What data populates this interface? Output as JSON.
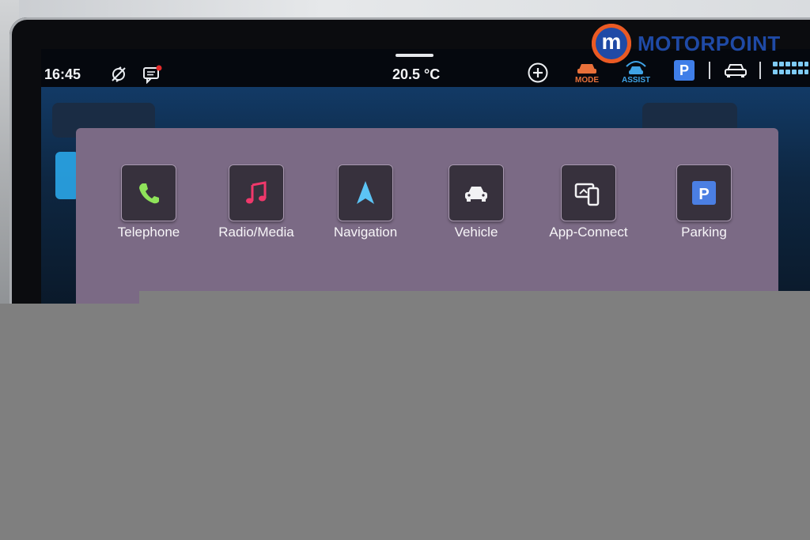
{
  "status_bar": {
    "time": "16:45",
    "temperature": "20.5 °C",
    "mode_label": "MODE",
    "assist_label": "ASSIST",
    "parking_badge": "P",
    "icons": [
      "sync-off-icon",
      "message-icon",
      "plus-icon",
      "car-icon",
      "grid-icon"
    ]
  },
  "apps": [
    {
      "label": "Telephone",
      "icon": "phone-icon"
    },
    {
      "label": "Radio/Media",
      "icon": "music-note-icon"
    },
    {
      "label": "Navigation",
      "icon": "navigation-arrow-icon"
    },
    {
      "label": "Vehicle",
      "icon": "car-icon"
    },
    {
      "label": "App-Connect",
      "icon": "app-connect-icon"
    },
    {
      "label": "Parking",
      "icon": "parking-icon"
    }
  ],
  "parking_glyph": "P",
  "watermark": {
    "logo_letter": "m",
    "brand": "MOTORPOINT"
  },
  "colors": {
    "panel": "#7b6a85",
    "tile": "#37313d",
    "mode": "#e8703a",
    "assist": "#3fa3e6",
    "parking": "#3f7ee8",
    "brand_blue": "#1f4aa6",
    "brand_orange": "#ea5a24"
  }
}
